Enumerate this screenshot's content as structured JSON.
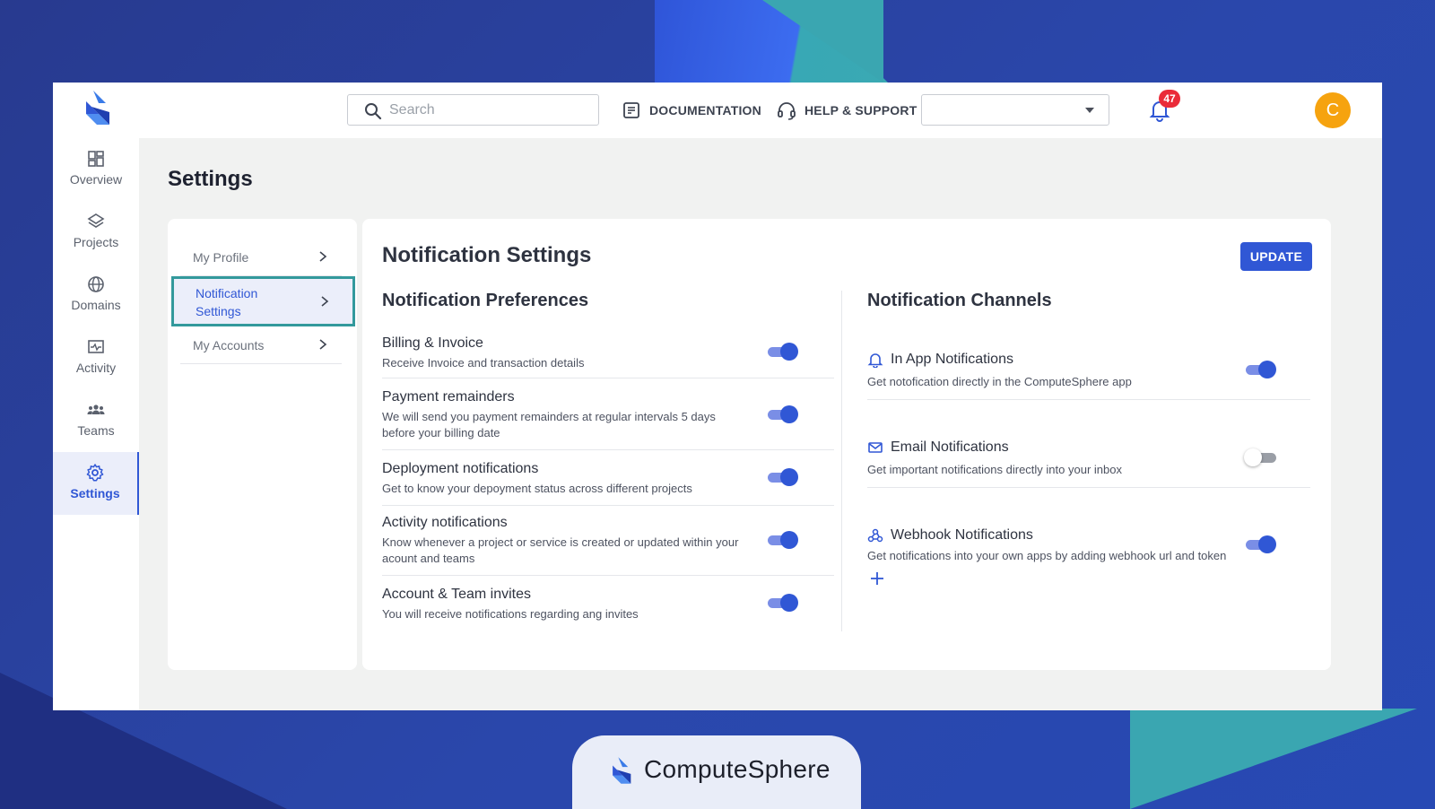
{
  "topbar": {
    "search_placeholder": "Search",
    "documentation_label": "DOCUMENTATION",
    "help_label": "HELP & SUPPORT",
    "notification_count": "47",
    "avatar_initial": "C"
  },
  "sidebar": {
    "items": [
      {
        "label": "Overview",
        "icon": "dashboard-icon"
      },
      {
        "label": "Projects",
        "icon": "layers-icon"
      },
      {
        "label": "Domains",
        "icon": "globe-icon"
      },
      {
        "label": "Activity",
        "icon": "activity-icon"
      },
      {
        "label": "Teams",
        "icon": "team-icon"
      },
      {
        "label": "Settings",
        "icon": "gear-icon",
        "active": true
      }
    ]
  },
  "page": {
    "title": "Settings"
  },
  "subnav": {
    "items": [
      {
        "label": "My Profile"
      },
      {
        "label": "Notification Settings",
        "active": true
      },
      {
        "label": "My Accounts"
      }
    ]
  },
  "panel": {
    "title": "Notification Settings",
    "update_label": "UPDATE"
  },
  "preferences": {
    "title": "Notification Preferences",
    "items": [
      {
        "title": "Billing & Invoice",
        "desc": "Receive Invoice and transaction details",
        "enabled": true
      },
      {
        "title": "Payment remainders",
        "desc": "We will send you payment remainders at regular intervals 5 days before your billing date",
        "enabled": true
      },
      {
        "title": "Deployment notifications",
        "desc": "Get to know your depoyment status across different projects",
        "enabled": true
      },
      {
        "title": "Activity notifications",
        "desc": "Know whenever a project or service is created or updated within your acount and teams",
        "enabled": true
      },
      {
        "title": "Account & Team invites",
        "desc": "You will receive notifications regarding ang invites",
        "enabled": true
      }
    ]
  },
  "channels": {
    "title": "Notification Channels",
    "items": [
      {
        "title": "In App Notifications",
        "desc": "Get notofication directly in the ComputeSphere app",
        "icon": "bell-icon",
        "enabled": true
      },
      {
        "title": "Email Notifications",
        "desc": "Get important notifications directly into your inbox",
        "icon": "mail-icon",
        "enabled": false
      },
      {
        "title": "Webhook Notifications",
        "desc": "Get notifications into your own apps by adding webhook url and token",
        "icon": "webhook-icon",
        "enabled": true
      }
    ]
  },
  "brand": {
    "name": "ComputeSphere"
  },
  "colors": {
    "accent": "#3057d5",
    "teal": "#3aa6b1",
    "badge": "#ea2b39",
    "avatar": "#f6a30f"
  }
}
